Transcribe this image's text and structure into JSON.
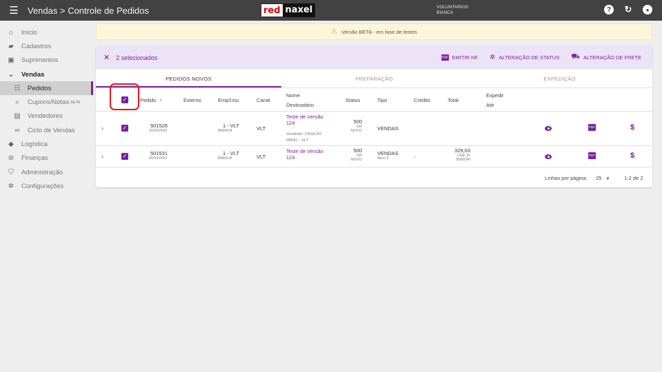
{
  "topbar": {
    "title": "Vendas > Controle de Pedidos",
    "logo_part1": "red",
    "logo_part2": "naxel",
    "user_line1": "VOLUNTARIOS",
    "user_line2": "BIANCA",
    "help_icon": "?",
    "refresh_icon": "↻",
    "account_icon": "●"
  },
  "sidebar": {
    "items": [
      {
        "label": "Início",
        "icon": "home-icon"
      },
      {
        "label": "Cadastros",
        "icon": "folder-icon"
      },
      {
        "label": "Suprimentos",
        "icon": "box-icon"
      },
      {
        "label": "Vendas",
        "icon": "chevron-down-icon"
      },
      {
        "label": "Pedidos",
        "icon": "list-icon"
      },
      {
        "label": "Cupons/Notas",
        "badge": "BETA",
        "icon": "receipt-search-icon"
      },
      {
        "label": "Vendedores",
        "icon": "id-card-icon"
      },
      {
        "label": "Ciclo de Vendas",
        "icon": "infinity-icon"
      },
      {
        "label": "Logística",
        "icon": "diamond-icon"
      },
      {
        "label": "Finanças",
        "icon": "money-icon"
      },
      {
        "label": "Administração",
        "icon": "shield-icon"
      },
      {
        "label": "Configurações",
        "icon": "gear-icon"
      }
    ]
  },
  "banner": {
    "text": "Versão BETA - em fase de testes"
  },
  "selection": {
    "count_label": "2 selecionados",
    "actions": {
      "emitir_nf": "EMITIR NF",
      "alteracao_status": "ALTERAÇÃO DE STATUS",
      "alteracao_frete": "ALTERAÇÃO DE FRETE"
    }
  },
  "tabs": [
    "PEDIDOS NOVOS",
    "PREPARAÇÃO",
    "EXPEDIÇÃO"
  ],
  "columns": {
    "pedido": "Pedido",
    "externo": "Externo",
    "emp_usu": "Emp/Usu",
    "canal": "Canal",
    "nome": "Nome",
    "destinatario": "Destinatário",
    "status": "Status",
    "tipo": "Tipo",
    "credito": "Crédito",
    "total": "Total",
    "expedir": "Expedir",
    "ate": "Até"
  },
  "rows": [
    {
      "pedido": "501526",
      "data": "15/03/2021",
      "emp": "1 - VLT",
      "usu": "BIANCA",
      "canal": "VLT",
      "nome_l1": "Teste de Versão",
      "nome_l2": "124",
      "vendedor_l1": "Vendedor: CASA DO",
      "vendedor_l2": "PAPEL - VLT",
      "status": "500",
      "status_sub1": "OR",
      "status_sub2": "NOVO",
      "tipo": "VENDAS",
      "tipo_sub": "",
      "credito": "",
      "total": "",
      "total_sub1": "",
      "total_sub2": ""
    },
    {
      "pedido": "501531",
      "data": "16/03/2021",
      "emp": "1 - VLT",
      "usu": "BIANCA",
      "canal": "VLT",
      "nome_l1": "Teste de Versão",
      "nome_l2": "124",
      "vendedor_l1": "",
      "vendedor_l2": "",
      "status": "500",
      "status_sub1": "OR",
      "status_sub2": "NOVO",
      "tipo": "VENDAS",
      "tipo_sub": "Itens 2",
      "credito": "-",
      "total": "329,03",
      "total_sub1": "CHE 3x",
      "total_sub2": "30/60/90"
    }
  ],
  "footer": {
    "rows_per_page_label": "Linhas por página:",
    "rows_per_page_value": "25",
    "range": "1-2 de 2"
  },
  "colors": {
    "accent": "#7b1fa2",
    "topbar": "#424242",
    "highlight": "#ee1111"
  }
}
